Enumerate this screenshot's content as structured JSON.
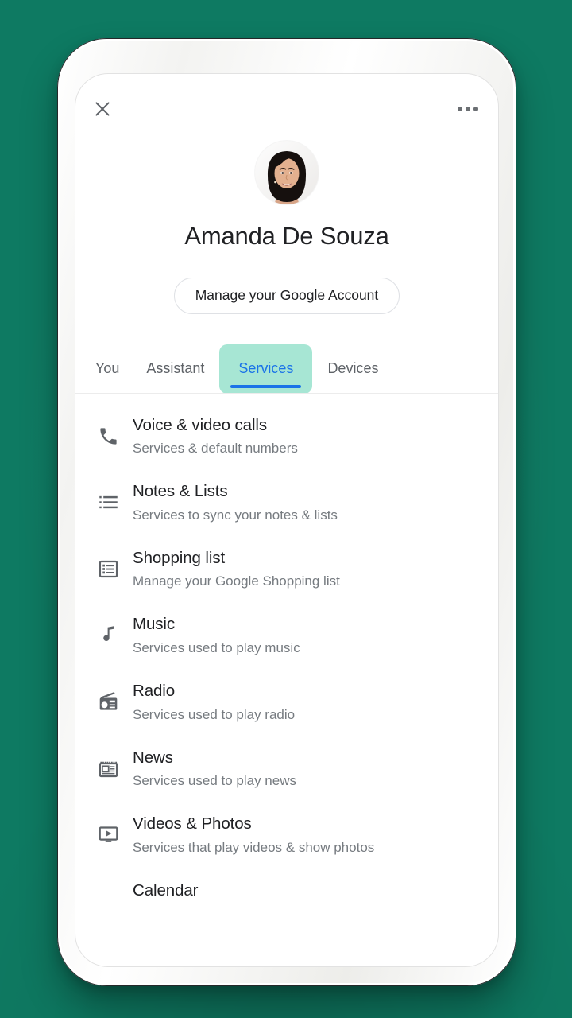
{
  "theme": {
    "background": "#0e7a62",
    "accent_blue": "#1a73e8",
    "tab_highlight": "#a7e6d4",
    "title_color": "#202124",
    "subtitle_color": "#767b80",
    "icon_color": "#5f6368"
  },
  "topbar": {
    "close_icon": "close-icon",
    "more_icon": "more-options-icon"
  },
  "profile": {
    "avatar_alt": "user-avatar",
    "name": "Amanda De Souza"
  },
  "manage_account": {
    "label": "Manage your Google Account"
  },
  "tabs": [
    {
      "label": "You",
      "active": false
    },
    {
      "label": "Assistant",
      "active": false
    },
    {
      "label": "Services",
      "active": true
    },
    {
      "label": "Devices",
      "active": false
    }
  ],
  "services": [
    {
      "icon": "phone-icon",
      "title": "Voice & video calls",
      "subtitle": "Services & default numbers"
    },
    {
      "icon": "notes-list-icon",
      "title": "Notes & Lists",
      "subtitle": "Services to sync your notes & lists"
    },
    {
      "icon": "shopping-list-icon",
      "title": "Shopping list",
      "subtitle": "Manage your Google Shopping list"
    },
    {
      "icon": "music-note-icon",
      "title": "Music",
      "subtitle": "Services used to play music"
    },
    {
      "icon": "radio-icon",
      "title": "Radio",
      "subtitle": "Services used to play radio"
    },
    {
      "icon": "newspaper-icon",
      "title": "News",
      "subtitle": "Services used to play news"
    },
    {
      "icon": "video-player-icon",
      "title": "Videos & Photos",
      "subtitle": "Services that play videos & show photos"
    },
    {
      "icon": "calendar-icon",
      "title": "Calendar",
      "subtitle": ""
    }
  ]
}
